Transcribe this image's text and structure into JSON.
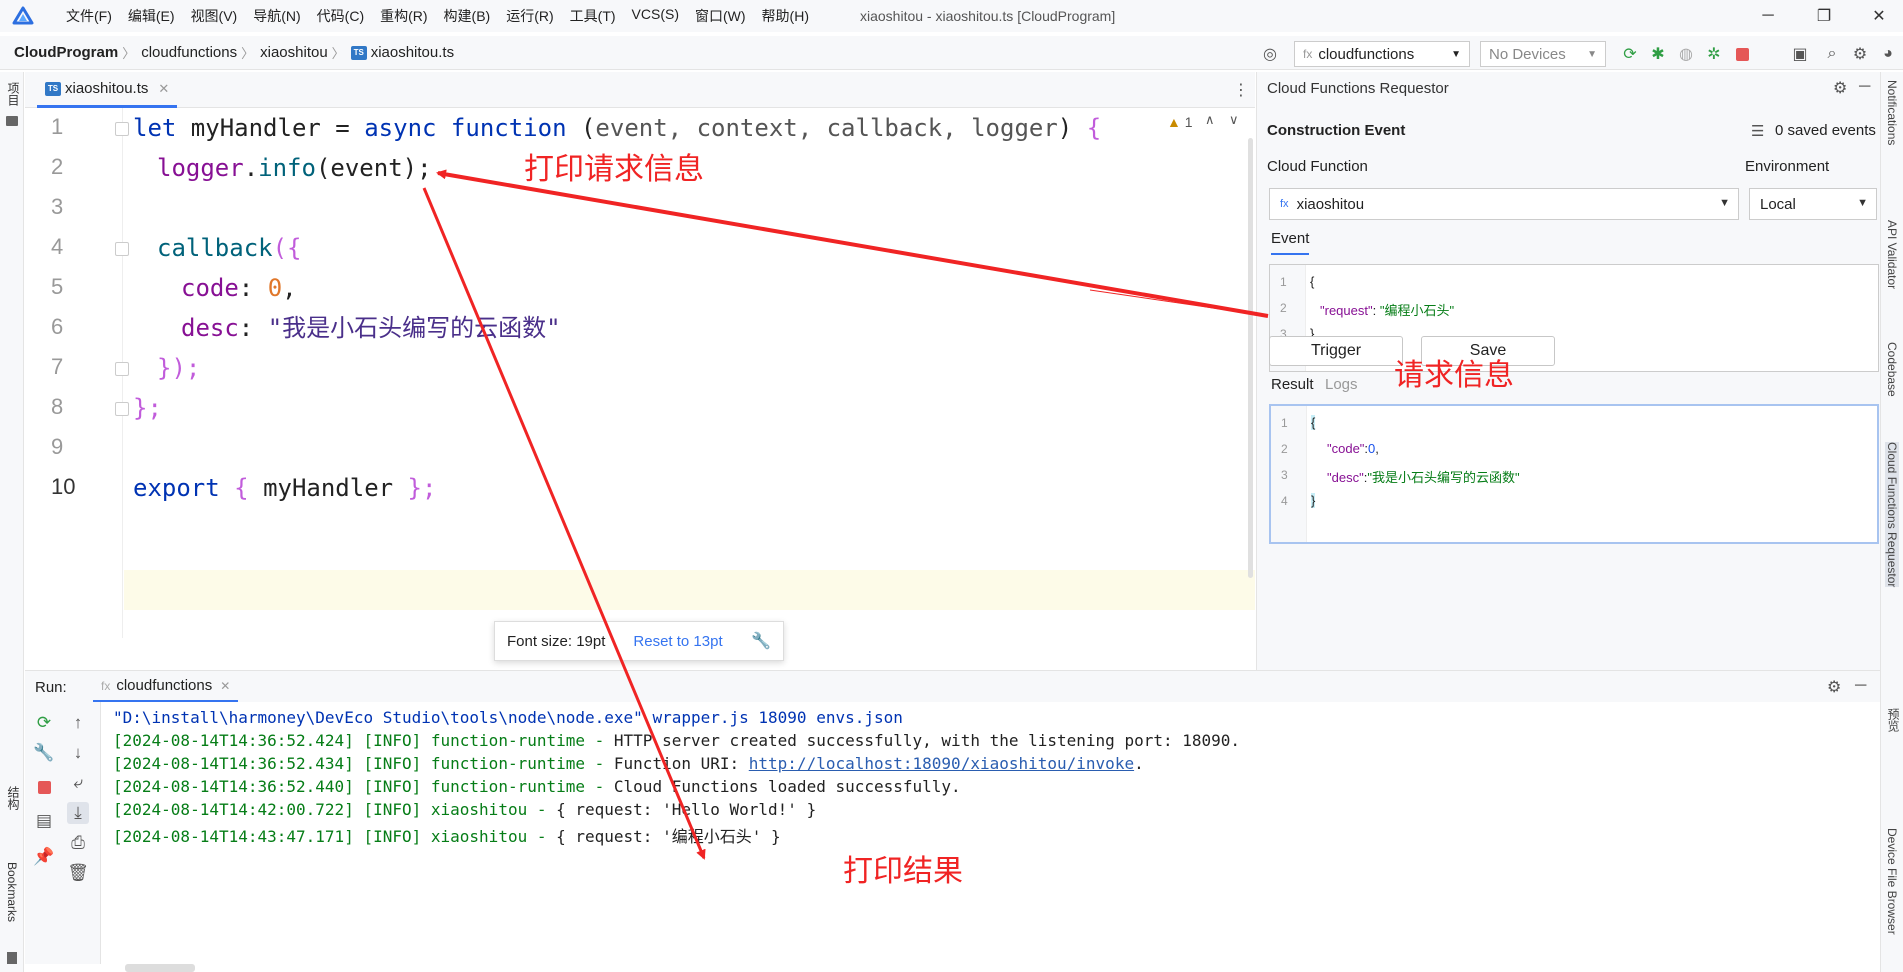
{
  "titlebar": {
    "menus": [
      "文件(F)",
      "编辑(E)",
      "视图(V)",
      "导航(N)",
      "代码(C)",
      "重构(R)",
      "构建(B)",
      "运行(R)",
      "工具(T)",
      "VCS(S)",
      "窗口(W)",
      "帮助(H)"
    ],
    "window_title": "xiaoshitou - xiaoshitou.ts [CloudProgram]",
    "minimize": "─",
    "maximize": "❐",
    "close": "✕"
  },
  "navbar": {
    "crumbs": [
      "CloudProgram",
      "cloudfunctions",
      "xiaoshitou",
      "xiaoshitou.ts"
    ],
    "ts_badge": "TS",
    "fx_prefix": "fx",
    "run_config": "cloudfunctions",
    "devices": "No Devices"
  },
  "left_strip": {
    "project": "项目",
    "structure": "结构",
    "bookmarks": "Bookmarks"
  },
  "right_strip": {
    "labels": [
      "Notifications",
      "API Validator",
      "Codebase",
      "Cloud Functions Requestor",
      "预览",
      "Device File Browser"
    ]
  },
  "editor": {
    "tab_label": "xiaoshitou.ts",
    "tab_close": "✕",
    "line_numbers": [
      "1",
      "2",
      "3",
      "4",
      "5",
      "6",
      "7",
      "8",
      "9",
      "10"
    ],
    "warning_count": "1",
    "code": {
      "l1_let": "let",
      "l1_name": " myHandler",
      "l1_eq": " = ",
      "l1_async": "async",
      "l1_sp": " ",
      "l1_function": "function",
      "l1_open": " (",
      "l1_params": "event, context, callback, logger",
      "l1_close": ")",
      "l1_brace": " {",
      "l2_logger": "logger",
      "l2_dot": ".",
      "l2_info": "info",
      "l2_args": "(event);",
      "l4_callback": "callback",
      "l4_open": "({",
      "l5_code": "code",
      "l5_colon": ": ",
      "l5_zero": "0",
      "l5_comma": ",",
      "l6_desc": "desc",
      "l6_colon": ": ",
      "l6_str": "\"我是小石头编写的云函数\"",
      "l7_close": "});",
      "l8_close": "};",
      "l10_export": "export",
      "l10_open": " { ",
      "l10_name": "myHandler",
      "l10_close": " };"
    }
  },
  "font_popup": {
    "size_text": "Font size: 19pt",
    "reset": "Reset to 13pt"
  },
  "requestor": {
    "title": "Cloud Functions Requestor",
    "construction_event": "Construction Event",
    "saved_events": "0 saved events",
    "cloud_function_label": "Cloud Function",
    "environment_label": "Environment",
    "function_value": "xiaoshitou",
    "fx_prefix": "fx",
    "environment_value": "Local",
    "event_tab": "Event",
    "event_lines": [
      "{",
      "\"request\": \"编程小石头\"",
      "}"
    ],
    "event_key": "\"request\"",
    "event_sep": ": ",
    "event_val": "\"编程小石头\"",
    "trigger": "Trigger",
    "save": "Save",
    "result_tab": "Result",
    "logs_tab": "Logs",
    "result_key_code": "\"code\"",
    "result_val_code": "0",
    "result_key_desc": "\"desc\"",
    "result_val_desc": "\"我是小石头编写的云函数\"",
    "result_open": "{",
    "result_close": "}",
    "comma": ",",
    "colon": ":",
    "line_nums": [
      "1",
      "2",
      "3",
      "4"
    ]
  },
  "run": {
    "label": "Run:",
    "fx_prefix": "fx",
    "tab": "cloudfunctions",
    "tab_close": "✕",
    "lines": [
      {
        "ts": "",
        "rest": "\"D:\\install\\harmoney\\DevEco Studio\\tools\\node\\node.exe\" wrapper.js 18090 envs.json"
      },
      {
        "ts": "[2024-08-14T14:36:52.424] [INFO] function-runtime - ",
        "rest": "HTTP server created successfully, with the listening port: 18090."
      },
      {
        "ts": "[2024-08-14T14:36:52.434] [INFO] function-runtime - ",
        "rest": "Function URI: ",
        "link": "http://localhost:18090/xiaoshitou/invoke",
        "tail": "."
      },
      {
        "ts": "[2024-08-14T14:36:52.440] [INFO] function-runtime - ",
        "rest": "Cloud Functions loaded successfully."
      },
      {
        "ts": "[2024-08-14T14:42:00.722] [INFO] xiaoshitou - ",
        "rest": "{ request: 'Hello World!' }"
      },
      {
        "ts": "[2024-08-14T14:43:47.171] [INFO] xiaoshitou - ",
        "rest": "{ request: '编程小石头' }"
      }
    ]
  },
  "annotations": {
    "print_request": "打印请求信息",
    "request_info": "请求信息",
    "print_result": "打印结果",
    "color": "#f02424"
  },
  "colors": {
    "accent": "#3574f0",
    "green": "#067d17",
    "stop_red": "#e55757"
  }
}
